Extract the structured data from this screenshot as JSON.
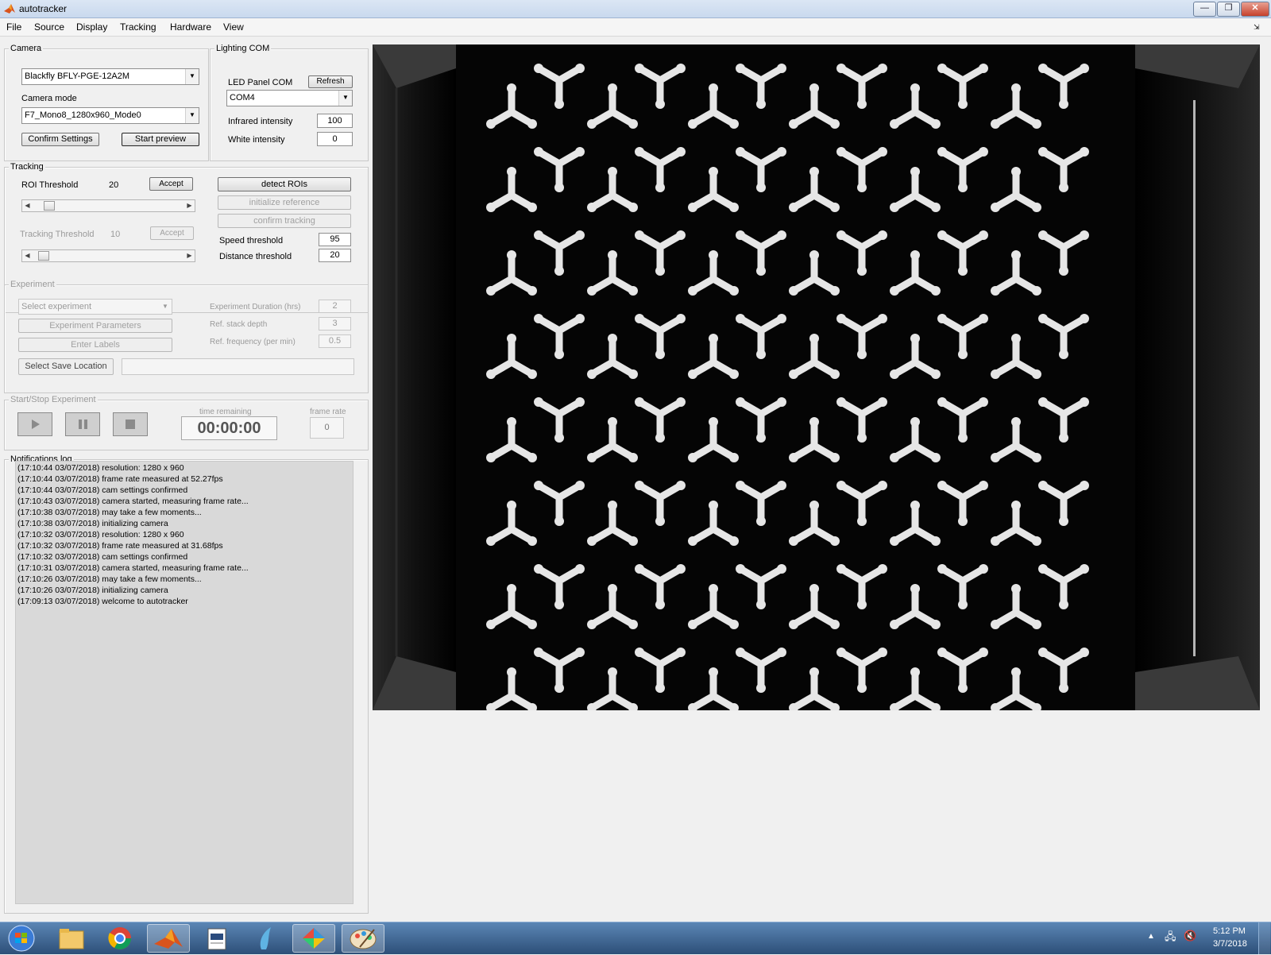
{
  "window": {
    "title": "autotracker",
    "minimize": "—",
    "maximize": "❐",
    "close": "✕"
  },
  "menu": [
    "File",
    "Source",
    "Display",
    "Tracking",
    "Hardware",
    "View"
  ],
  "camera": {
    "group_title": "Camera",
    "device_value": "Blackfly BFLY-PGE-12A2M",
    "mode_label": "Camera mode",
    "mode_value": "F7_Mono8_1280x960_Mode0",
    "confirm_label": "Confirm Settings",
    "preview_label": "Start preview"
  },
  "lighting": {
    "group_title": "Lighting COM",
    "led_label": "LED Panel COM",
    "refresh_label": "Refresh",
    "com_value": "COM4",
    "ir_label": "Infrared intensity",
    "ir_value": "100",
    "white_label": "White intensity",
    "white_value": "0"
  },
  "tracking": {
    "group_title": "Tracking",
    "roi_label": "ROI Threshold",
    "roi_value": "20",
    "roi_level": 20,
    "accept_label": "Accept",
    "tracking_label": "Tracking Threshold",
    "tracking_value": "10",
    "tracking_level": 10,
    "accept2_label": "Accept",
    "detect_label": "detect ROIs",
    "init_label": "initialize reference",
    "confirm_label": "confirm tracking",
    "speed_label": "Speed threshold",
    "speed_value": "95",
    "distance_label": "Distance threshold",
    "distance_value": "20"
  },
  "experiment": {
    "group_title": "Experiment",
    "select_value": "Select experiment",
    "params_label": "Experiment Parameters",
    "labels_label": "Enter Labels",
    "save_label": "Select Save Location",
    "save_path": "",
    "duration_label": "Experiment Duration (hrs)",
    "duration_value": "2",
    "stack_label": "Ref. stack depth",
    "stack_value": "3",
    "freq_label": "Ref. frequency (per min)",
    "freq_value": "0.5"
  },
  "startstop": {
    "group_title": "Start/Stop Experiment",
    "time_label": "time remaining",
    "time_value": "00:00:00",
    "rate_label": "frame rate",
    "rate_value": "0"
  },
  "log": {
    "group_title": "Notifications log",
    "lines": [
      "(17:10:44 03/07/2018)  resolution: 1280 x 960",
      "(17:10:44 03/07/2018)  frame rate measured at 52.27fps",
      "(17:10:44 03/07/2018)  cam settings confirmed",
      "(17:10:43 03/07/2018)  camera started, measuring frame rate...",
      "(17:10:38 03/07/2018)  may take a few moments...",
      "(17:10:38 03/07/2018)  initializing camera",
      "(17:10:32 03/07/2018)  resolution: 1280 x 960",
      "(17:10:32 03/07/2018)  frame rate measured at 31.68fps",
      "(17:10:32 03/07/2018)  cam settings confirmed",
      "(17:10:31 03/07/2018)  camera started, measuring frame rate...",
      "(17:10:26 03/07/2018)  may take a few moments...",
      "(17:10:26 03/07/2018)  initializing camera",
      "(17:09:13 03/07/2018)  welcome to autotracker"
    ]
  },
  "taskbar": {
    "apps": [
      "start-orb",
      "file-explorer",
      "chrome",
      "matlab",
      "document-viewer",
      "fish-app",
      "colorful-app",
      "paint"
    ],
    "time": "5:12 PM",
    "date": "3/7/2018"
  },
  "colors": {
    "accent": "#2d4f78",
    "panel": "#f0f0f0",
    "camera_bg": "#050505"
  }
}
